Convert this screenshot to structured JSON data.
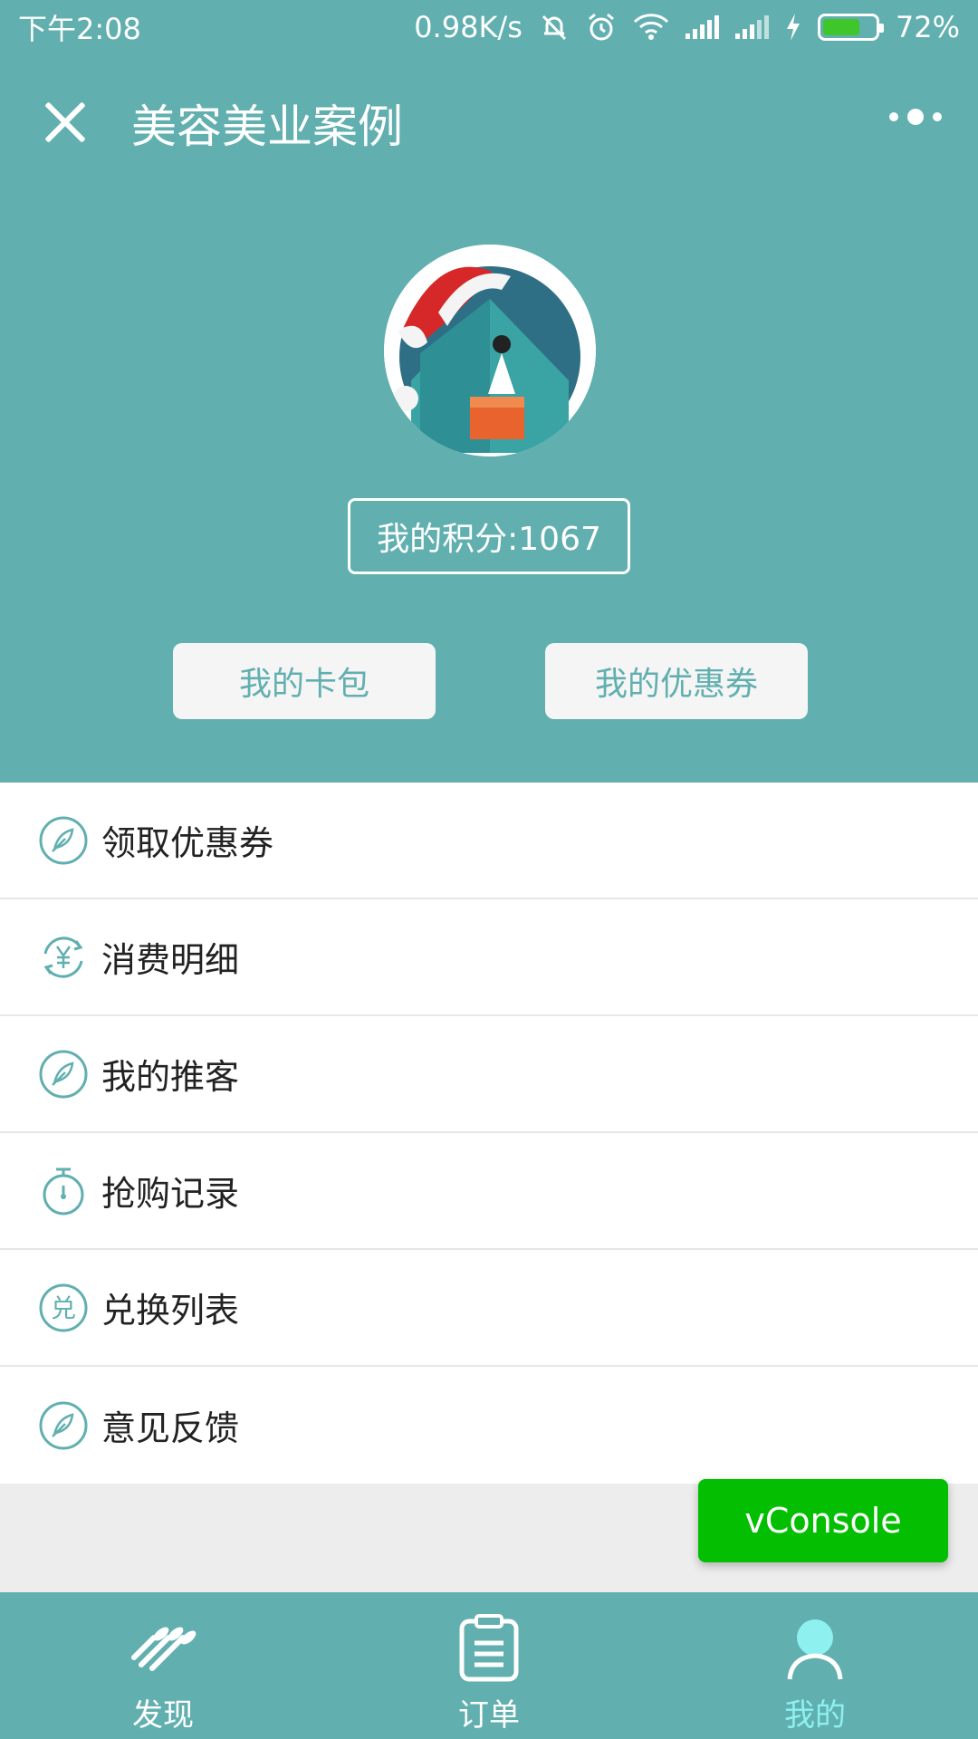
{
  "status_bar": {
    "time": "下午2:08",
    "network_speed": "0.98K/s",
    "battery_percent": "72%",
    "battery_level": 0.72,
    "icons": [
      "mute-icon",
      "alarm-icon",
      "wifi-icon",
      "signal-icon",
      "signal-icon",
      "charging-icon",
      "battery-icon"
    ]
  },
  "header": {
    "title": "美容美业案例",
    "close_icon": "close-icon",
    "more_icon": "more-icon"
  },
  "profile": {
    "points_label": "我的积分:1067",
    "card_button": "我的卡包",
    "coupon_button": "我的优惠券"
  },
  "menu": {
    "items": [
      {
        "label": "领取优惠券",
        "icon": "feather-icon"
      },
      {
        "label": "消费明细",
        "icon": "yuan-refresh-icon"
      },
      {
        "label": "我的推客",
        "icon": "feather-icon"
      },
      {
        "label": "抢购记录",
        "icon": "stopwatch-icon"
      },
      {
        "label": "兑换列表",
        "icon": "exchange-icon"
      },
      {
        "label": "意见反馈",
        "icon": "feather-icon"
      }
    ]
  },
  "vconsole": {
    "label": "vConsole"
  },
  "tab_bar": {
    "tabs": [
      {
        "label": "发现",
        "icon": "discover-icon",
        "active": false
      },
      {
        "label": "订单",
        "icon": "order-icon",
        "active": false
      },
      {
        "label": "我的",
        "icon": "user-icon",
        "active": true
      }
    ]
  },
  "colors": {
    "theme": "#61afaf",
    "active_tab": "#8ff0f0",
    "vconsole": "#04be02",
    "battery": "#3ec62b"
  }
}
